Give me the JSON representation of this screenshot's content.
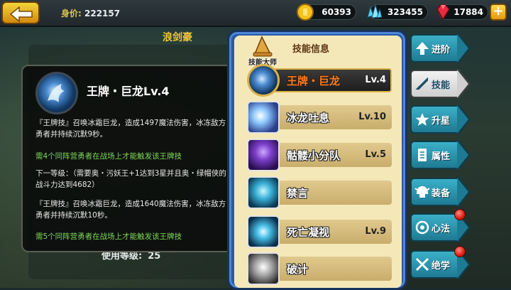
{
  "topbar": {
    "worth_label": "身价:",
    "worth_value": "222157",
    "gold": "60393",
    "crystal": "323455",
    "ruby": "17884",
    "plus": "+"
  },
  "hero": {
    "name": "浪剑豪"
  },
  "left_panel": {
    "used_level_label": "使用等级:",
    "used_level_value": "25"
  },
  "tooltip": {
    "title": "王牌・巨龙Lv.4",
    "desc1": "『王牌技』召唤冰霜巨龙，造成1497魔法伤害，冰冻敌方勇者并持续沉默9秒。",
    "cond1": "需4个同阵营勇者在战场上才能触发该王牌技",
    "next_level": "下一等级：（需要奥・污妖王+1达到3星并且奥・绿帽侠的战斗力达到4682）",
    "desc2": "『王牌技』召唤冰霜巨龙，造成1640魔法伤害，冰冻敌方勇者并持续沉默10秒。",
    "cond2": "需5个同阵营勇者在战场上才能触发该王牌技"
  },
  "skill_panel": {
    "title": "技能信息",
    "master_label": "技能大师",
    "skills": [
      {
        "name": "王牌・巨龙",
        "level": "Lv.4",
        "icon": "ice-dragon-icon",
        "selected": true
      },
      {
        "name": "冰龙吐息",
        "level": "Lv.10",
        "icon": "ice-breath-icon"
      },
      {
        "name": "骷髅小分队",
        "level": "Lv.5",
        "icon": "skeleton-squad-icon"
      },
      {
        "name": "禁言",
        "level": "",
        "icon": "silence-icon"
      },
      {
        "name": "死亡凝视",
        "level": "Lv.9",
        "icon": "death-gaze-icon"
      },
      {
        "name": "破计",
        "level": "",
        "icon": "skill-icon"
      }
    ]
  },
  "tabs": [
    {
      "label": "进阶",
      "icon": "upgrade-arrow-icon"
    },
    {
      "label": "技能",
      "icon": "sword-icon",
      "active": true
    },
    {
      "label": "升星",
      "icon": "star-icon"
    },
    {
      "label": "属性",
      "icon": "document-icon"
    },
    {
      "label": "装备",
      "icon": "helmet-icon"
    },
    {
      "label": "心法",
      "icon": "swirl-icon",
      "badge": true
    },
    {
      "label": "绝学",
      "icon": "cross-swords-icon",
      "badge": true
    }
  ],
  "colors": {
    "gold": "#f0c53c",
    "tab_blue": "#1e7a93",
    "panel_frame": "#2a5aa8",
    "green_text": "#7ed957"
  }
}
